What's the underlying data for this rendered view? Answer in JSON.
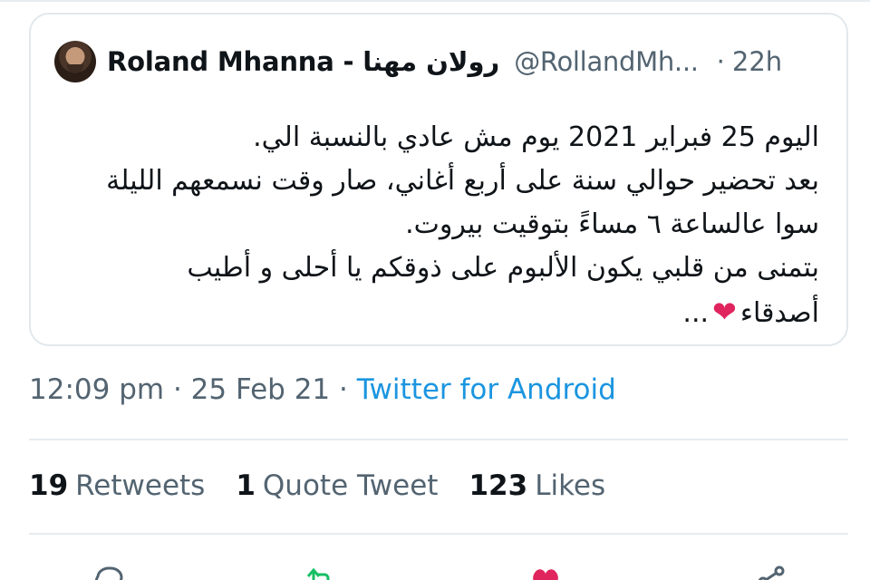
{
  "quoted_tweet": {
    "display_name": "Roland Mhanna - رولان مهنا",
    "handle": "@RollandMh...",
    "separator": "·",
    "time_ago": "22h",
    "body_lines": [
      "اليوم 25 فبراير 2021 يوم مش عادي بالنسبة الي.",
      "بعد تحضير حوالي سنة على أربع أغاني، صار وقت نسمعهم الليلة",
      "سوا عالساعة ٦ مساءً بتوقيت بيروت.",
      "بتمنى من قلبي يكون الألبوم على ذوقكم يا أحلى و أطيب",
      "أصدقاء"
    ],
    "body_ellipsis": "...",
    "heart_emoji": "❤"
  },
  "meta": {
    "time": "12:09 pm",
    "sep1": "·",
    "date": "25 Feb 21",
    "sep2": "·",
    "source": "Twitter for Android"
  },
  "stats": {
    "retweets_count": "19",
    "retweets_label": "Retweets",
    "quotes_count": "1",
    "quotes_label": "Quote Tweet",
    "likes_count": "123",
    "likes_label": "Likes"
  },
  "colors": {
    "accent_blue": "#1b95e0",
    "like_red": "#e0245e",
    "retweet_green": "#17bf63",
    "secondary_text": "#536471"
  },
  "icons": [
    "reply-icon",
    "retweet-icon",
    "like-icon",
    "share-icon"
  ]
}
